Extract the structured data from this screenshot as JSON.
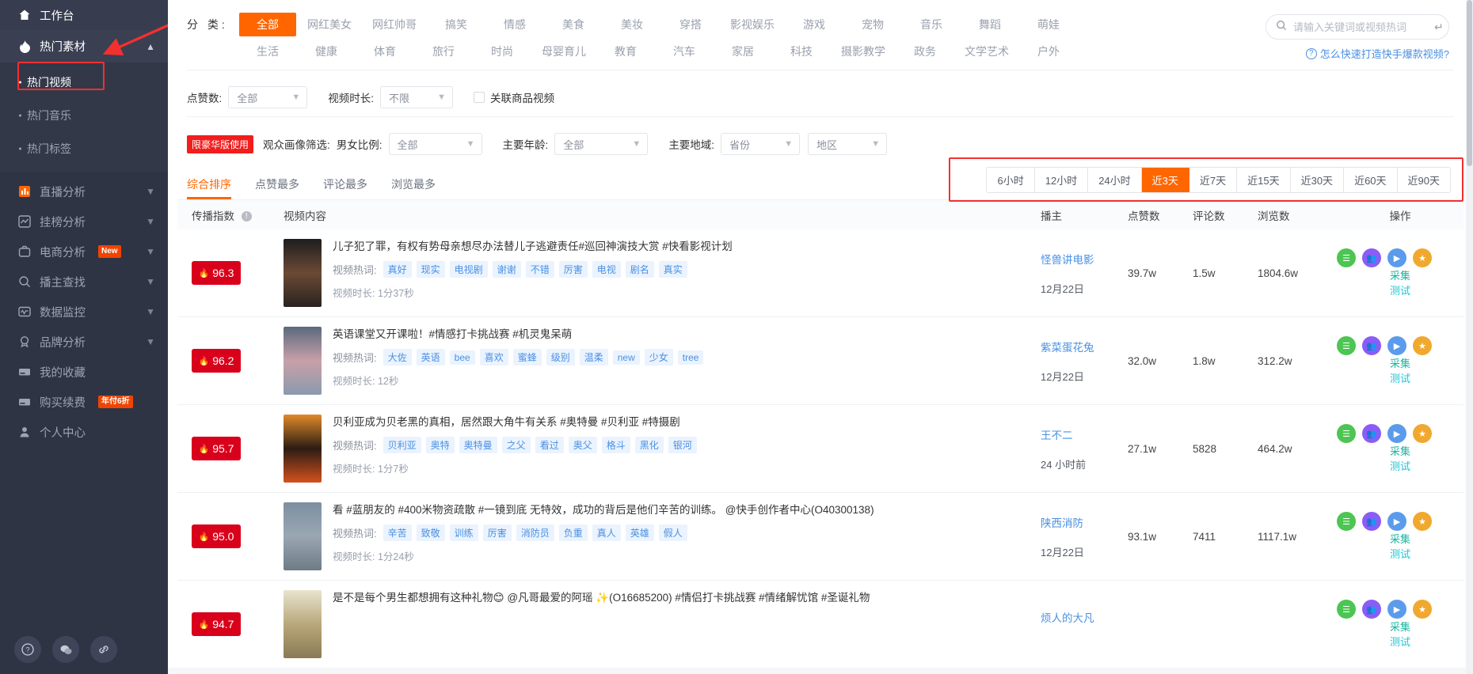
{
  "sidebar": {
    "workbench": {
      "label": "工作台",
      "icon": "home-icon"
    },
    "group": {
      "label": "热门素材",
      "icon": "flame-icon",
      "caret": "chevron-up-icon"
    },
    "sub_items": [
      {
        "label": "热门视频",
        "active": true
      },
      {
        "label": "热门音乐",
        "active": false
      },
      {
        "label": "热门标签",
        "active": false
      }
    ],
    "items": [
      {
        "label": "直播分析",
        "icon": "bar-chart-icon",
        "caret": true,
        "badge": ""
      },
      {
        "label": "挂榜分析",
        "icon": "line-chart-icon",
        "caret": true,
        "badge": ""
      },
      {
        "label": "电商分析",
        "icon": "briefcase-icon",
        "caret": true,
        "badge": "New"
      },
      {
        "label": "播主查找",
        "icon": "search-icon",
        "caret": true,
        "badge": ""
      },
      {
        "label": "数据监控",
        "icon": "monitor-icon",
        "caret": true,
        "badge": ""
      },
      {
        "label": "品牌分析",
        "icon": "medal-icon",
        "caret": true,
        "badge": ""
      },
      {
        "label": "我的收藏",
        "icon": "card-icon",
        "caret": false,
        "badge": ""
      },
      {
        "label": "购买续费",
        "icon": "card-icon",
        "caret": false,
        "badge": "年付6折"
      },
      {
        "label": "个人中心",
        "icon": "user-icon",
        "caret": false,
        "badge": ""
      }
    ],
    "bottom_buttons": [
      {
        "name": "help-button",
        "glyph": "?"
      },
      {
        "name": "wechat-button",
        "glyph": "✆"
      },
      {
        "name": "link-button",
        "glyph": "🔗"
      }
    ]
  },
  "category": {
    "label": "分 类:",
    "row1": [
      "全部",
      "网红美女",
      "网红帅哥",
      "搞笑",
      "情感",
      "美食",
      "美妆",
      "穿搭",
      "影视娱乐",
      "游戏",
      "宠物",
      "音乐",
      "舞蹈",
      "萌娃"
    ],
    "row2": [
      "生活",
      "健康",
      "体育",
      "旅行",
      "时尚",
      "母婴育儿",
      "教育",
      "汽车",
      "家居",
      "科技",
      "摄影教学",
      "政务",
      "文学艺术",
      "户外"
    ],
    "active": "全部"
  },
  "search": {
    "placeholder": "请输入关键词或视频热词",
    "value": "",
    "icon": "search-icon",
    "enter_icon": "enter-key-icon"
  },
  "help_link": {
    "text": "怎么快速打造快手爆款视频?",
    "icon": "question-circle-icon"
  },
  "filters": {
    "likes": {
      "label": "点赞数:",
      "value": "全部"
    },
    "duration": {
      "label": "视频时长:",
      "value": "不限"
    },
    "checkbox": {
      "label": "关联商品视频",
      "checked": false
    },
    "premium_tag": "限豪华版使用",
    "audience_label": "观众画像筛选:",
    "gender": {
      "label": "男女比例:",
      "value": "全部"
    },
    "age": {
      "label": "主要年龄:",
      "value": "全部"
    },
    "region": {
      "label": "主要地域:",
      "value": "省份"
    },
    "region2": {
      "value": "地区"
    }
  },
  "sort_tabs": [
    {
      "label": "综合排序",
      "active": true
    },
    {
      "label": "点赞最多",
      "active": false
    },
    {
      "label": "评论最多",
      "active": false
    },
    {
      "label": "浏览最多",
      "active": false
    }
  ],
  "time_tabs": [
    {
      "label": "6小时",
      "active": false
    },
    {
      "label": "12小时",
      "active": false
    },
    {
      "label": "24小时",
      "active": false
    },
    {
      "label": "近3天",
      "active": true
    },
    {
      "label": "近7天",
      "active": false
    },
    {
      "label": "近15天",
      "active": false
    },
    {
      "label": "近30天",
      "active": false
    },
    {
      "label": "近60天",
      "active": false
    },
    {
      "label": "近90天",
      "active": false
    }
  ],
  "table": {
    "headers": {
      "index": "传播指数",
      "content": "视频内容",
      "author": "播主",
      "likes": "点赞数",
      "comments": "评论数",
      "views": "浏览数",
      "ops": "操作"
    },
    "hot_words_label": "视频热词:",
    "duration_label": "视频时长:",
    "op_links": {
      "collect": "采集",
      "test": "测试"
    },
    "op_icons": [
      {
        "name": "note-icon",
        "color": "#4cc552",
        "glyph": "☰"
      },
      {
        "name": "group-icon",
        "color": "#8b5cf6",
        "glyph": "👥"
      },
      {
        "name": "play-icon",
        "color": "#5b9bec",
        "glyph": "▶"
      },
      {
        "name": "star-icon",
        "color": "#f0a92e",
        "glyph": "★"
      }
    ],
    "rows": [
      {
        "score": "96.3",
        "title": "儿子犯了罪，有权有势母亲想尽办法替儿子逃避责任#巡回神演技大赏 #快看影视计划",
        "hot_words": [
          "真好",
          "现实",
          "电视剧",
          "谢谢",
          "不错",
          "厉害",
          "电视",
          "剧名",
          "真实"
        ],
        "duration": "1分37秒",
        "author": "怪兽讲电影",
        "date": "12月22日",
        "likes": "39.7w",
        "comments": "1.5w",
        "views": "1804.6w",
        "thumb_colors": [
          "#1d1d1f",
          "#6b4a35",
          "#2a2320"
        ]
      },
      {
        "score": "96.2",
        "title": "英语课堂又开课啦！#情感打卡挑战赛 #机灵鬼呆萌",
        "hot_words": [
          "大佐",
          "英语",
          "bee",
          "喜欢",
          "蜜蜂",
          "级别",
          "温柔",
          "new",
          "少女",
          "tree"
        ],
        "duration": "12秒",
        "author": "紫菜蛋花兔",
        "date": "12月22日",
        "likes": "32.0w",
        "comments": "1.8w",
        "views": "312.2w",
        "thumb_colors": [
          "#5a6a7d",
          "#c8a0a8",
          "#8a9aad"
        ]
      },
      {
        "score": "95.7",
        "title": "贝利亚成为贝老黑的真相，居然跟大角牛有关系 #奥特曼 #贝利亚 #特摄剧",
        "hot_words": [
          "贝利亚",
          "奥特",
          "奥特曼",
          "之父",
          "看过",
          "奥父",
          "格斗",
          "黑化",
          "银河"
        ],
        "duration": "1分7秒",
        "author": "王不二",
        "date": "24 小时前",
        "likes": "27.1w",
        "comments": "5828",
        "views": "464.2w",
        "thumb_colors": [
          "#e08a2a",
          "#2b1c14",
          "#d4511e"
        ]
      },
      {
        "score": "95.0",
        "title": "看 #蓝朋友的 #400米物资疏散 #一镜到底 无特效，成功的背后是他们辛苦的训练。 @快手创作者中心(O40300138)",
        "hot_words": [
          "辛苦",
          "致敬",
          "训练",
          "厉害",
          "消防员",
          "负重",
          "真人",
          "英雄",
          "假人"
        ],
        "duration": "1分24秒",
        "author": "陕西消防",
        "date": "12月22日",
        "likes": "93.1w",
        "comments": "7411",
        "views": "1117.1w",
        "thumb_colors": [
          "#7c8fa0",
          "#9aa7b3",
          "#6d7c88"
        ]
      },
      {
        "score": "94.7",
        "title": "是不是每个男生都想拥有这种礼物😊 @凡哥最爱的阿瑶 ✨(O16685200) #情侣打卡挑战赛 #情绪解忧馆 #圣诞礼物",
        "hot_words": [],
        "duration": "",
        "author": "烦人的大凡",
        "date": "",
        "likes": "",
        "comments": "",
        "views": "",
        "thumb_colors": [
          "#e8e4d0",
          "#b9a87a",
          "#8a7a55"
        ]
      }
    ]
  }
}
